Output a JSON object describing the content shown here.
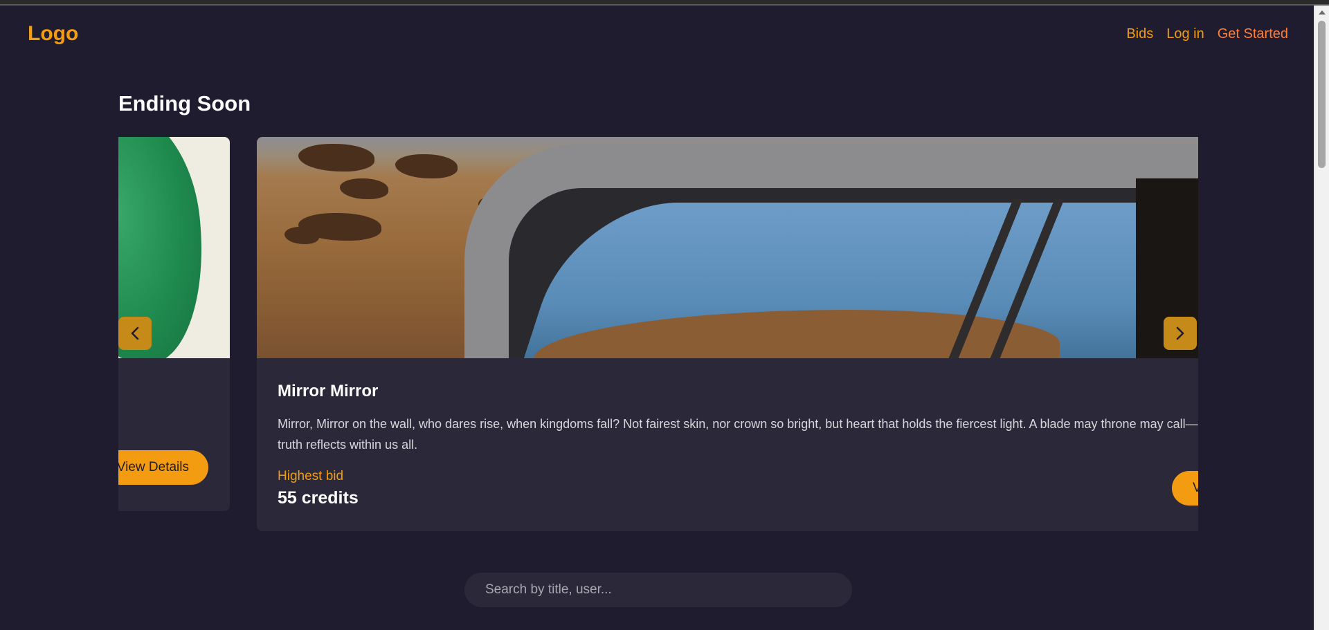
{
  "header": {
    "logo": "Logo",
    "nav": [
      {
        "label": "Bids"
      },
      {
        "label": "Log in"
      },
      {
        "label": "Get Started"
      }
    ]
  },
  "section": {
    "title": "Ending Soon"
  },
  "carousel": {
    "prev_icon": "chevron-left-icon",
    "next_icon": "chevron-right-icon",
    "cards": [
      {
        "image": "green-leaf-photo",
        "view_label": "View Details"
      },
      {
        "image": "car-mirror-desert-photo",
        "title": "Mirror Mirror",
        "description": "Mirror, Mirror on the wall, who dares rise, when kingdoms fall? Not fairest skin, nor crown so bright, but heart that holds the fiercest light. A blade may throne may call— but truth reflects within us all.",
        "bid_label": "Highest bid",
        "bid_value": "55 credits",
        "view_label": "View Details"
      }
    ]
  },
  "search": {
    "placeholder": "Search by title, user..."
  },
  "colors": {
    "background": "#1e1c2e",
    "card": "#2b2939",
    "accent": "#f39c12"
  }
}
